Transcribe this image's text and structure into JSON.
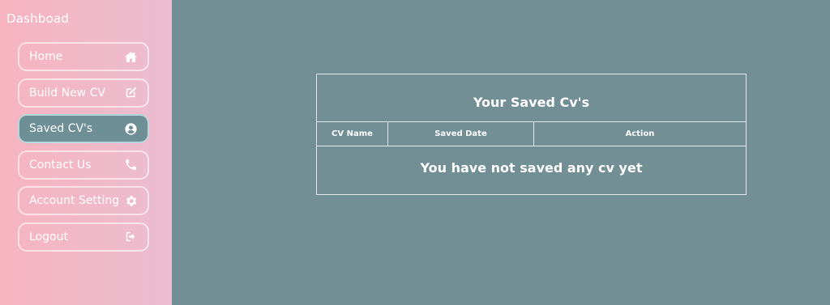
{
  "sidebar": {
    "brand": "Dashboad",
    "items": [
      {
        "label": "Home",
        "icon": "home-icon"
      },
      {
        "label": "Build New CV",
        "icon": "edit-icon"
      },
      {
        "label": "Saved CV's",
        "icon": "user-circle-icon",
        "active": true
      },
      {
        "label": "Contact Us",
        "icon": "phone-icon"
      },
      {
        "label": "Account Setting",
        "icon": "gear-icon"
      },
      {
        "label": "Logout",
        "icon": "sign-out-icon"
      }
    ]
  },
  "main": {
    "title": "Your Saved Cv's",
    "columns": [
      "CV Name",
      "Saved Date",
      "Action"
    ],
    "empty_message": "You have not saved any cv yet"
  },
  "colors": {
    "sidebar_gradient_start": "#f7b4c0",
    "sidebar_gradient_end": "#ebbdd0",
    "main_background": "#728f96",
    "active_item": "#6f8f96"
  }
}
